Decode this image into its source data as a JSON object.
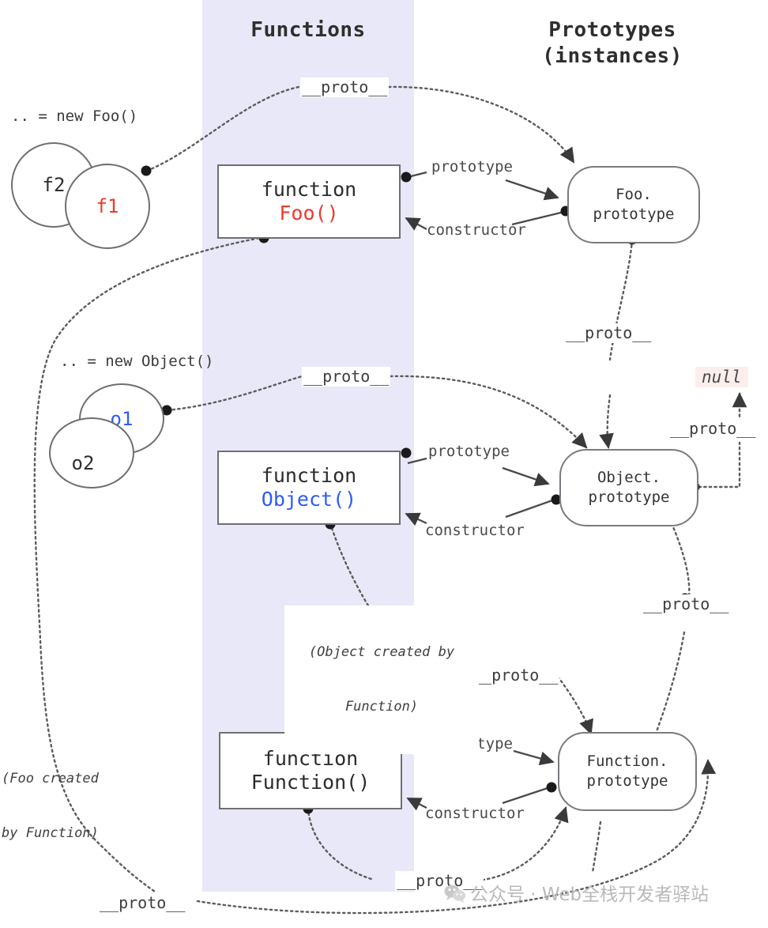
{
  "columns": {
    "functions": {
      "title": "Functions"
    },
    "prototypes": {
      "line1": "Prototypes",
      "line2": "(instances)"
    }
  },
  "instances": {
    "foo_decl": ".. = new Foo()",
    "f1": "f1",
    "f2": "f2",
    "object_decl": ".. = new Object()",
    "o1": "o1",
    "o2": "o2"
  },
  "functions": [
    {
      "keyword": "function",
      "name": "Foo()",
      "color": "#ec3b2b"
    },
    {
      "keyword": "function",
      "name": "Object()",
      "color": "#2d5cf5"
    },
    {
      "keyword": "function",
      "name": "Function()",
      "color": "#2b2b2b"
    }
  ],
  "prototypes": [
    {
      "line1": "Foo.",
      "line2": "prototype"
    },
    {
      "line1": "Object.",
      "line2": "prototype"
    },
    {
      "line1": "Function.",
      "line2": "prototype"
    }
  ],
  "edges": {
    "proto": "__proto__",
    "prototype": "prototype",
    "constructor": "constructor"
  },
  "labels": {
    "proto_f1": "__proto__",
    "proto_o1": "__proto__",
    "proto_foo_to_objproto": "__proto__",
    "proto_objproto_to_null": "__proto__",
    "proto_objproto_down": "__proto__",
    "proto_objfn_to_funcproto": "__proto__",
    "proto_foofn_bottom": "__proto__",
    "proto_funcfn_bottom": "__proto__",
    "null_value": "null",
    "note_object_created": "(Object created by\nFunction)",
    "note_foo_created": "(Foo created\nby Function)"
  },
  "watermark": {
    "text": "公众号 · Web全栈开发者驿站"
  },
  "colors": {
    "band": "#e9e8f8",
    "box_border": "#6f6f74",
    "red": "#ec3b2b",
    "blue": "#2d5cf5",
    "null_bg": "#fceeec",
    "text": "#3b3b3b"
  }
}
